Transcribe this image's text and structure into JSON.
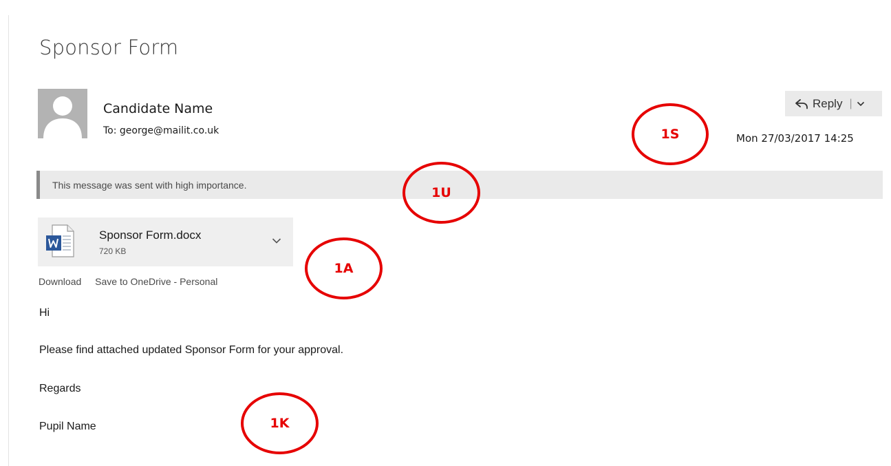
{
  "email": {
    "subject": "Sponsor Form",
    "sender_name": "Candidate Name",
    "to_line": "To: george@mailit.co.uk",
    "date": "Mon 27/03/2017 14:25",
    "reply_label": "Reply",
    "reply_separator": "|",
    "importance_notice": "This message was sent with high importance."
  },
  "attachment": {
    "filename": "Sponsor Form.docx",
    "size": "720 KB",
    "icon": "word-doc-icon",
    "actions": {
      "download": "Download",
      "save_onedrive": "Save to OneDrive - Personal"
    }
  },
  "body": {
    "greeting": "Hi",
    "message": "Please find attached updated Sponsor Form for your approval.",
    "closing": "Regards",
    "signature": "Pupil Name"
  },
  "markers": {
    "sender": "1S",
    "urgency": "1U",
    "attachment": "1A",
    "knowledge": "1K"
  },
  "colors": {
    "marker_red": "#e60000",
    "word_blue": "#2b579a",
    "bar_grey": "#eaeaea"
  }
}
